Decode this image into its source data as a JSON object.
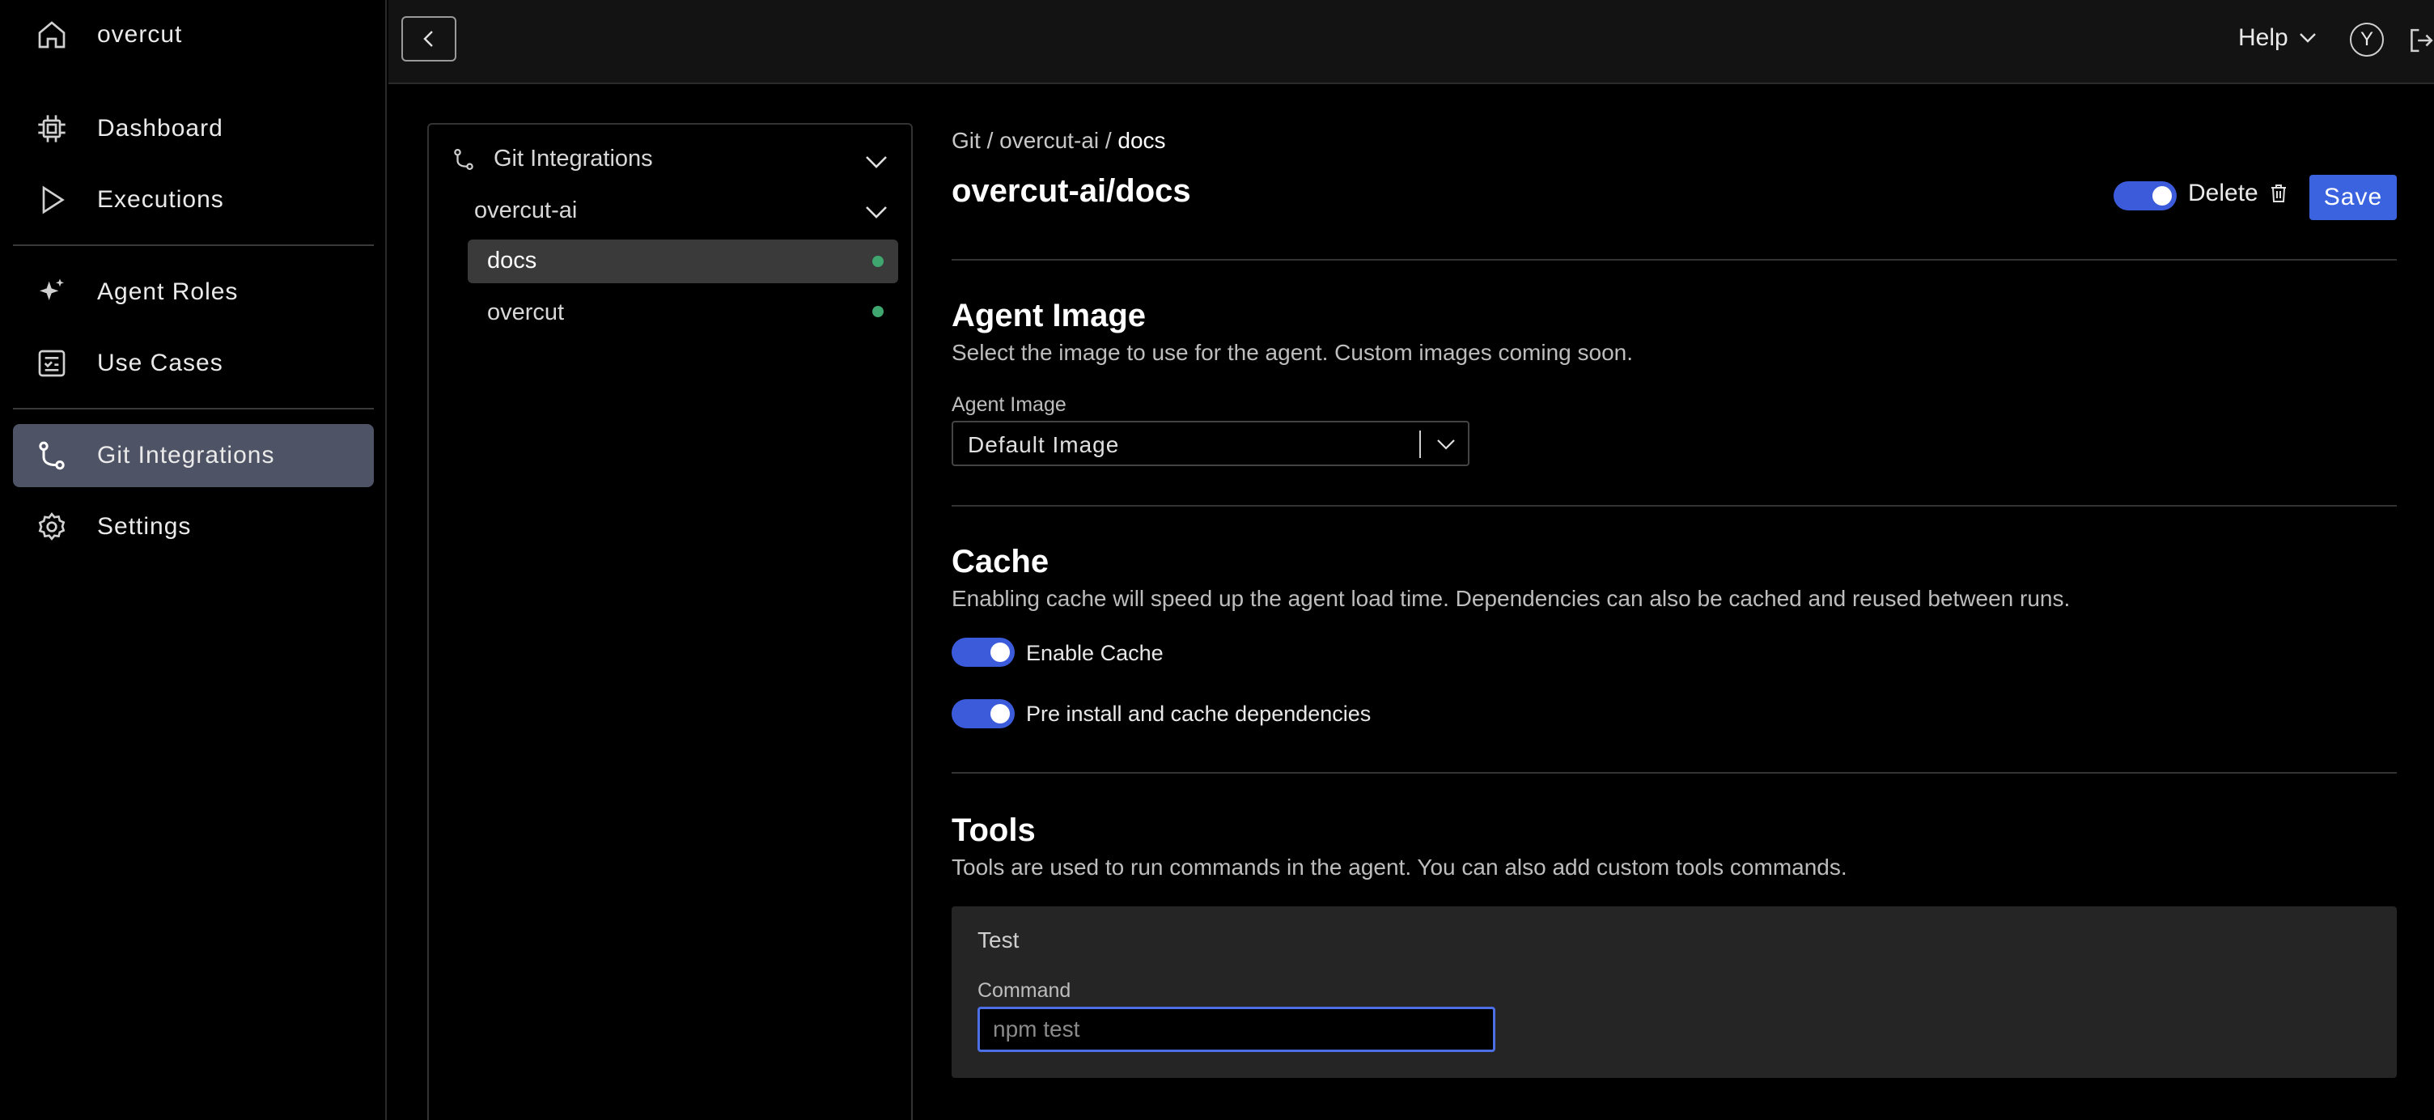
{
  "app": {
    "name": "overcut"
  },
  "sidebar": {
    "items": [
      {
        "label": "Dashboard"
      },
      {
        "label": "Executions"
      },
      {
        "label": "Agent Roles"
      },
      {
        "label": "Use Cases"
      },
      {
        "label": "Git Integrations"
      },
      {
        "label": "Settings"
      }
    ]
  },
  "topbar": {
    "help_label": "Help",
    "avatar_initial": "Y"
  },
  "tree": {
    "root_label": "Git Integrations",
    "org_label": "overcut-ai",
    "repos": [
      {
        "label": "docs",
        "selected": true,
        "status_color": "#3fa66f"
      },
      {
        "label": "overcut",
        "selected": false,
        "status_color": "#3fa66f"
      }
    ]
  },
  "breadcrumb": {
    "part1": "Git",
    "sep": "/",
    "part2": "overcut-ai",
    "current": "docs"
  },
  "page": {
    "title": "overcut-ai/docs",
    "enabled": true,
    "delete_label": "Delete",
    "save_label": "Save"
  },
  "agent_image": {
    "title": "Agent Image",
    "description": "Select the image to use for the agent. Custom images coming soon.",
    "field_label": "Agent Image",
    "selected": "Default Image"
  },
  "cache": {
    "title": "Cache",
    "description": "Enabling cache will speed up the agent load time. Dependencies can also be cached and reused between runs.",
    "enable_cache_label": "Enable Cache",
    "enable_cache_on": true,
    "preinstall_label": "Pre install and cache dependencies",
    "preinstall_on": true
  },
  "tools": {
    "title": "Tools",
    "description": "Tools are used to run commands in the agent. You can also add custom tools commands.",
    "items": [
      {
        "name": "Test",
        "command_label": "Command",
        "command_value": "",
        "command_placeholder": "npm test"
      }
    ]
  },
  "colors": {
    "accent": "#3b63e0",
    "active_nav": "#4e5465",
    "status_ok": "#3fa66f"
  }
}
